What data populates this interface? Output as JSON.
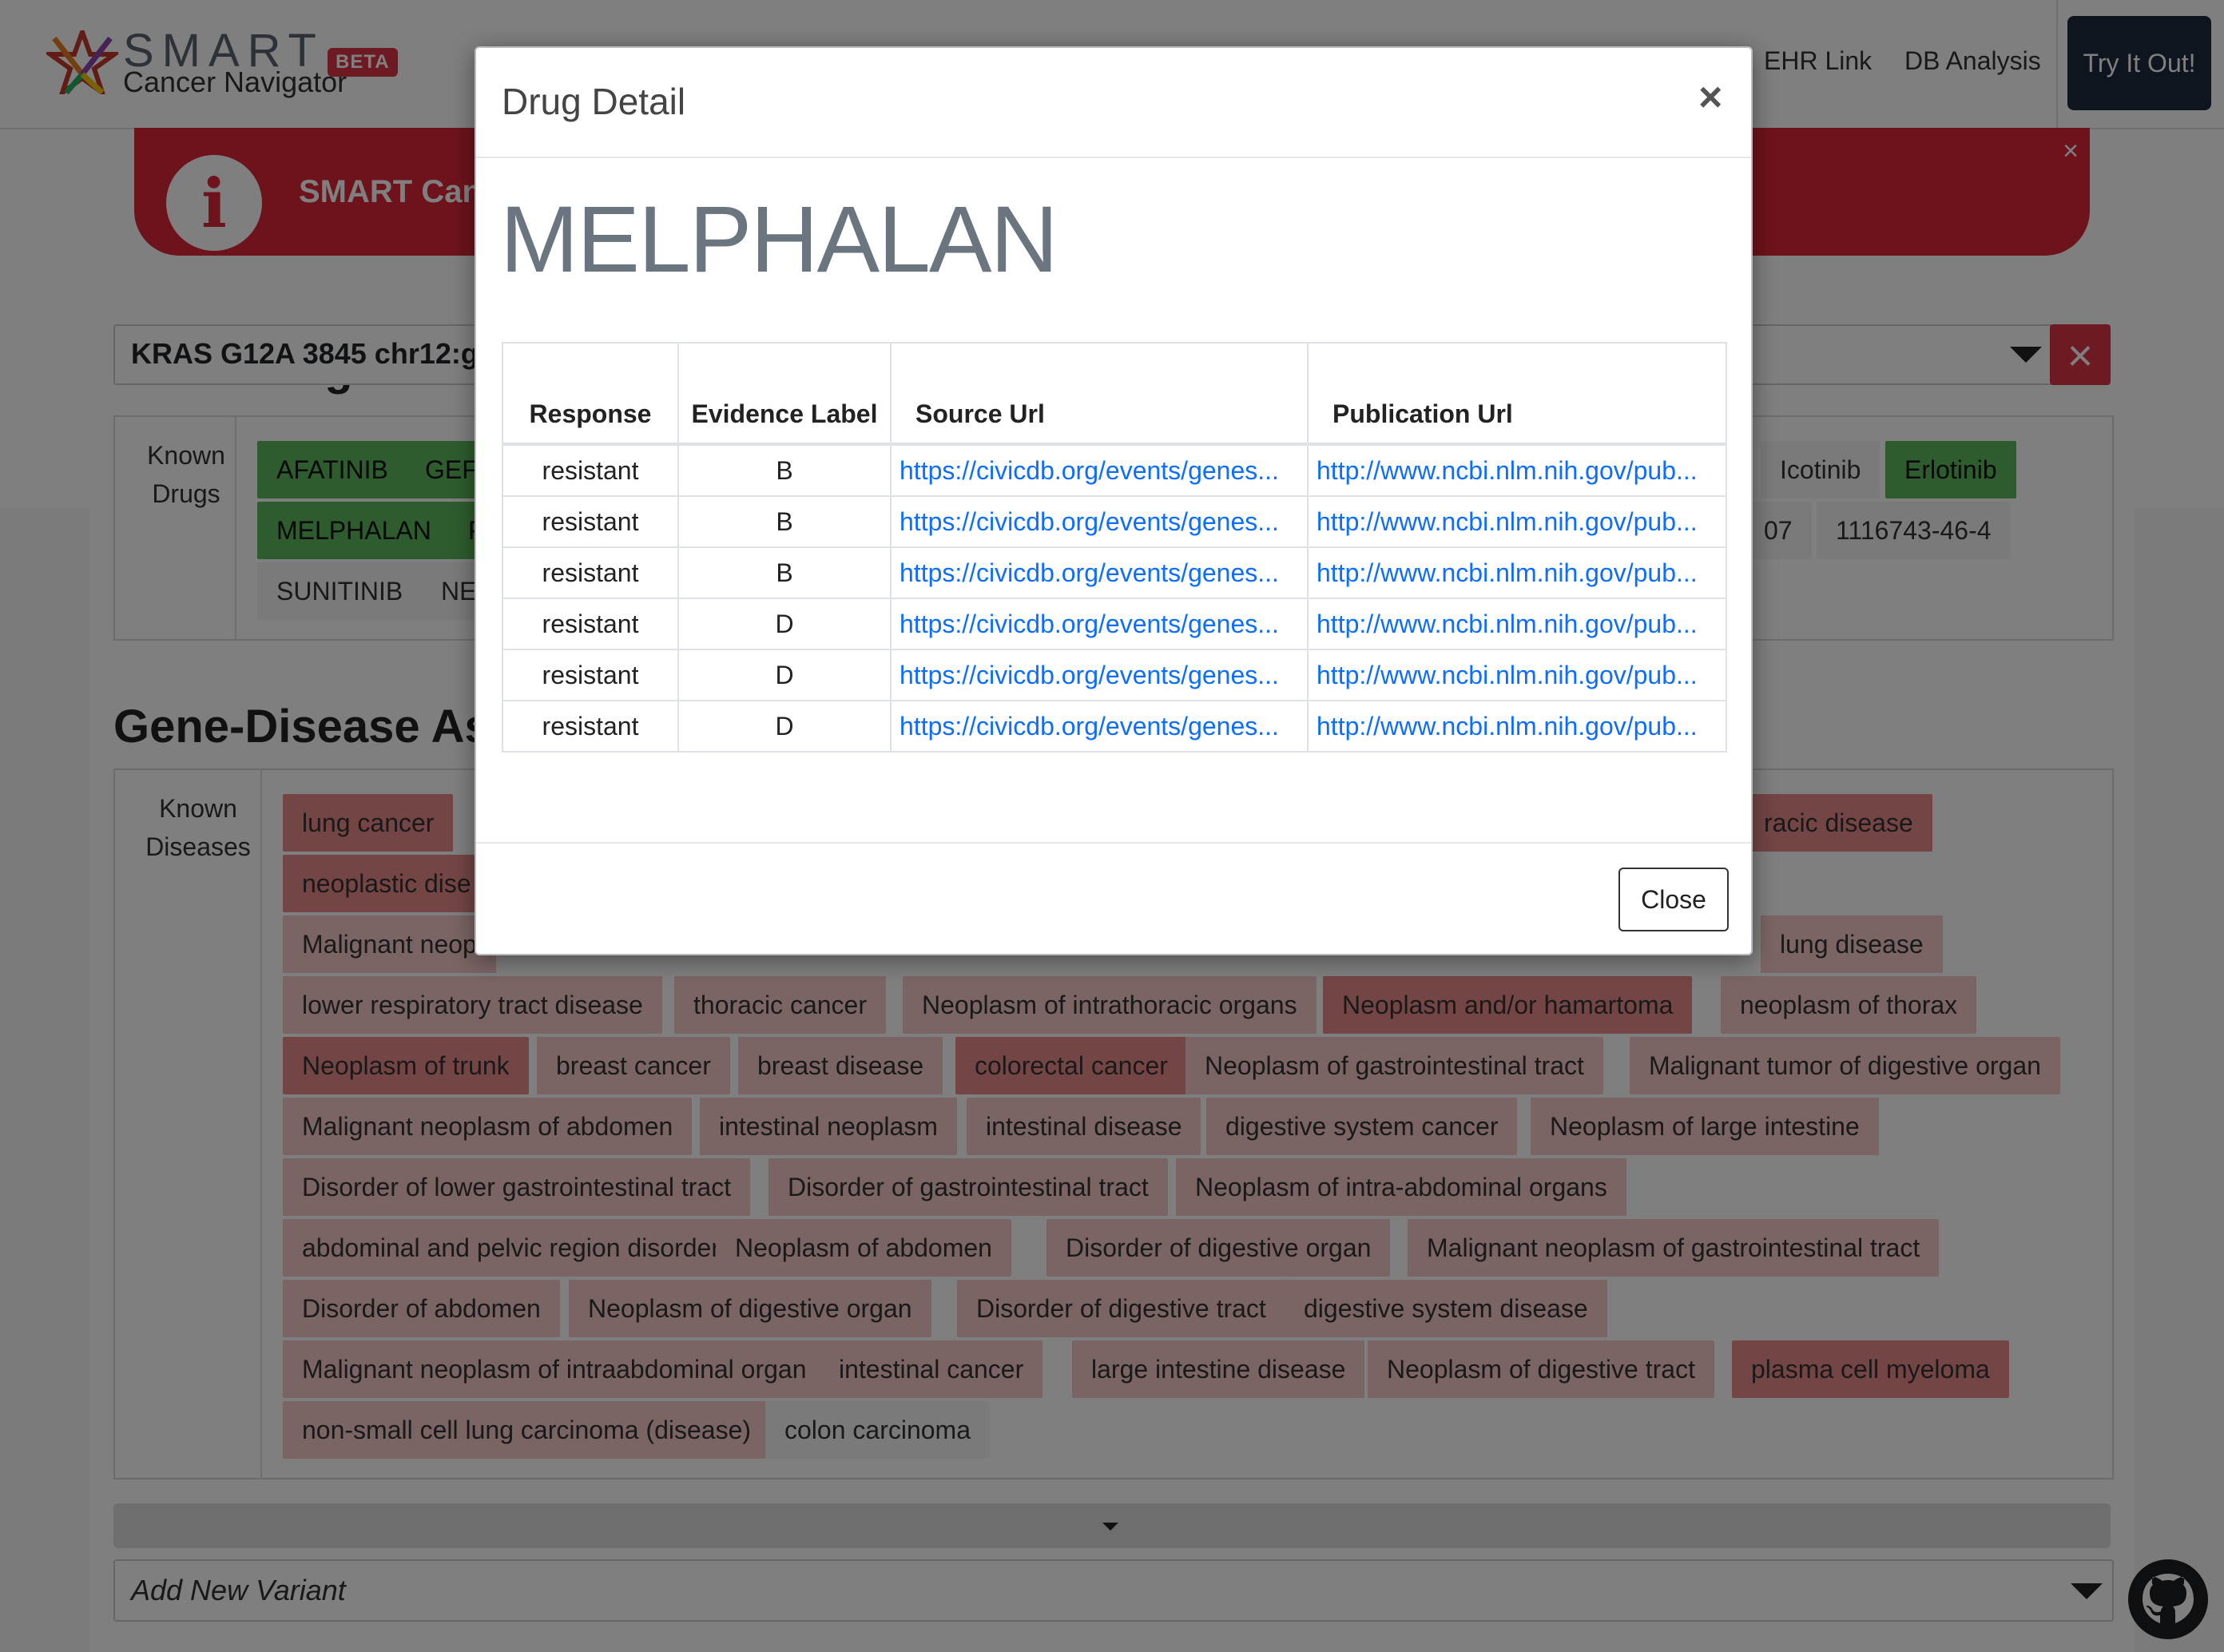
{
  "navbar": {
    "logo_main": "SMART",
    "logo_sub": "Cancer Navigator",
    "beta": "BETA",
    "links": [
      "EHR Link",
      "DB Analysis"
    ],
    "try_button": "Try It Out!"
  },
  "alert": {
    "text": "SMART Can",
    "close": "×"
  },
  "variant": {
    "selected": "KRAS G12A 3845 chr12:g"
  },
  "gene_drug": {
    "heading": "Gene-Drug Assoc",
    "label": "Known Drugs",
    "row1": [
      "AFATINIB",
      "GEFI"
    ],
    "row1_right": [
      "Icotinib",
      "Erlotinib"
    ],
    "row2": [
      "MELPHALAN",
      "P"
    ],
    "row2_right": [
      "07",
      "1116743-46-4"
    ],
    "row3": [
      "SUNITINIB",
      "NE"
    ]
  },
  "gene_disease": {
    "heading": "Gene-Disease Ass",
    "label": "Known Diseases",
    "row1": [
      "lung cancer"
    ],
    "row1_right": "racic disease",
    "row2": [
      "neoplastic dise"
    ],
    "row3_left": "Malignant neop",
    "row3_right": "lung disease",
    "rows": [
      [
        "lower respiratory tract disease",
        "thoracic cancer",
        "Neoplasm of intrathoracic organs",
        "Neoplasm and/or hamartoma",
        "neoplasm of thorax"
      ],
      [
        "Neoplasm of trunk",
        "breast cancer",
        "breast disease",
        "colorectal cancer",
        "Neoplasm of gastrointestinal tract",
        "Malignant tumor of digestive organ"
      ],
      [
        "Malignant neoplasm of abdomen",
        "intestinal neoplasm",
        "intestinal disease",
        "digestive system cancer",
        "Neoplasm of large intestine"
      ],
      [
        "Disorder of lower gastrointestinal tract",
        "Disorder of gastrointestinal tract",
        "Neoplasm of intra-abdominal organs"
      ],
      [
        "abdominal and pelvic region disorder",
        "Neoplasm of abdomen",
        "Disorder of digestive organ",
        "Malignant neoplasm of gastrointestinal tract"
      ],
      [
        "Disorder of abdomen",
        "Neoplasm of digestive organ",
        "Disorder of digestive tract",
        "digestive system disease"
      ],
      [
        "Malignant neoplasm of intraabdominal organ",
        "intestinal cancer",
        "large intestine disease",
        "Neoplasm of digestive tract",
        "plasma cell myeloma"
      ],
      [
        "non-small cell lung carcinoma (disease)",
        "colon carcinoma"
      ]
    ]
  },
  "add_variant": {
    "placeholder": "Add New Variant"
  },
  "modal": {
    "title": "Drug Detail",
    "close_x": "×",
    "drug_name": "MELPHALAN",
    "columns": {
      "response": "Response",
      "evidence": "Evidence Label",
      "source": "Source Url",
      "publication": "Publication Url"
    },
    "rows": [
      {
        "response": "resistant",
        "evidence": "B",
        "source": "https://civicdb.org/events/genes...",
        "publication": "http://www.ncbi.nlm.nih.gov/pub..."
      },
      {
        "response": "resistant",
        "evidence": "B",
        "source": "https://civicdb.org/events/genes...",
        "publication": "http://www.ncbi.nlm.nih.gov/pub..."
      },
      {
        "response": "resistant",
        "evidence": "B",
        "source": "https://civicdb.org/events/genes...",
        "publication": "http://www.ncbi.nlm.nih.gov/pub..."
      },
      {
        "response": "resistant",
        "evidence": "D",
        "source": "https://civicdb.org/events/genes...",
        "publication": "http://www.ncbi.nlm.nih.gov/pub..."
      },
      {
        "response": "resistant",
        "evidence": "D",
        "source": "https://civicdb.org/events/genes...",
        "publication": "http://www.ncbi.nlm.nih.gov/pub..."
      },
      {
        "response": "resistant",
        "evidence": "D",
        "source": "https://civicdb.org/events/genes...",
        "publication": "http://www.ncbi.nlm.nih.gov/pub..."
      }
    ],
    "close_button": "Close"
  }
}
